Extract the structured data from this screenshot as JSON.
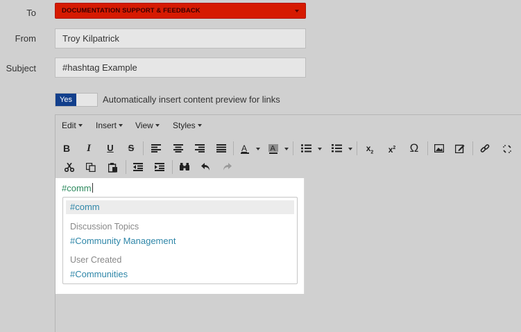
{
  "form": {
    "to_label": "To",
    "to_value": "DOCUMENTATION SUPPORT & FEEDBACK",
    "from_label": "From",
    "from_value": "Troy Kilpatrick",
    "subject_label": "Subject",
    "subject_value": "#hashtag Example",
    "toggle_on_label": "Yes",
    "toggle_text": "Automatically insert content preview for links"
  },
  "colors": {
    "to_select_bg": "#d61a00",
    "toggle_on_bg": "#123f8c",
    "hashtag_text": "#2d8a5e",
    "link_text": "#2e86a8"
  },
  "editor": {
    "menus": [
      "Edit",
      "Insert",
      "View",
      "Styles"
    ],
    "toolbar_row1_icons": [
      "bold-icon",
      "italic-icon",
      "underline-icon",
      "strikethrough-icon",
      "align-left-icon",
      "align-center-icon",
      "align-right-icon",
      "align-justify-icon",
      "text-color-icon",
      "background-color-icon",
      "bullet-list-icon",
      "numbered-list-icon",
      "subscript-icon",
      "superscript-icon",
      "omega-icon",
      "image-icon",
      "edit-icon",
      "link-icon",
      "unlink-icon"
    ],
    "toolbar_row2_icons": [
      "cut-icon",
      "copy-icon",
      "paste-icon",
      "outdent-icon",
      "indent-icon",
      "find-icon",
      "undo-icon",
      "redo-icon"
    ],
    "typed_text": "#comm"
  },
  "autocomplete": {
    "selected": "#comm",
    "groups": [
      {
        "heading": "Discussion Topics",
        "items": [
          "#Community Management"
        ]
      },
      {
        "heading": "User Created",
        "items": [
          "#Communities"
        ]
      }
    ]
  }
}
